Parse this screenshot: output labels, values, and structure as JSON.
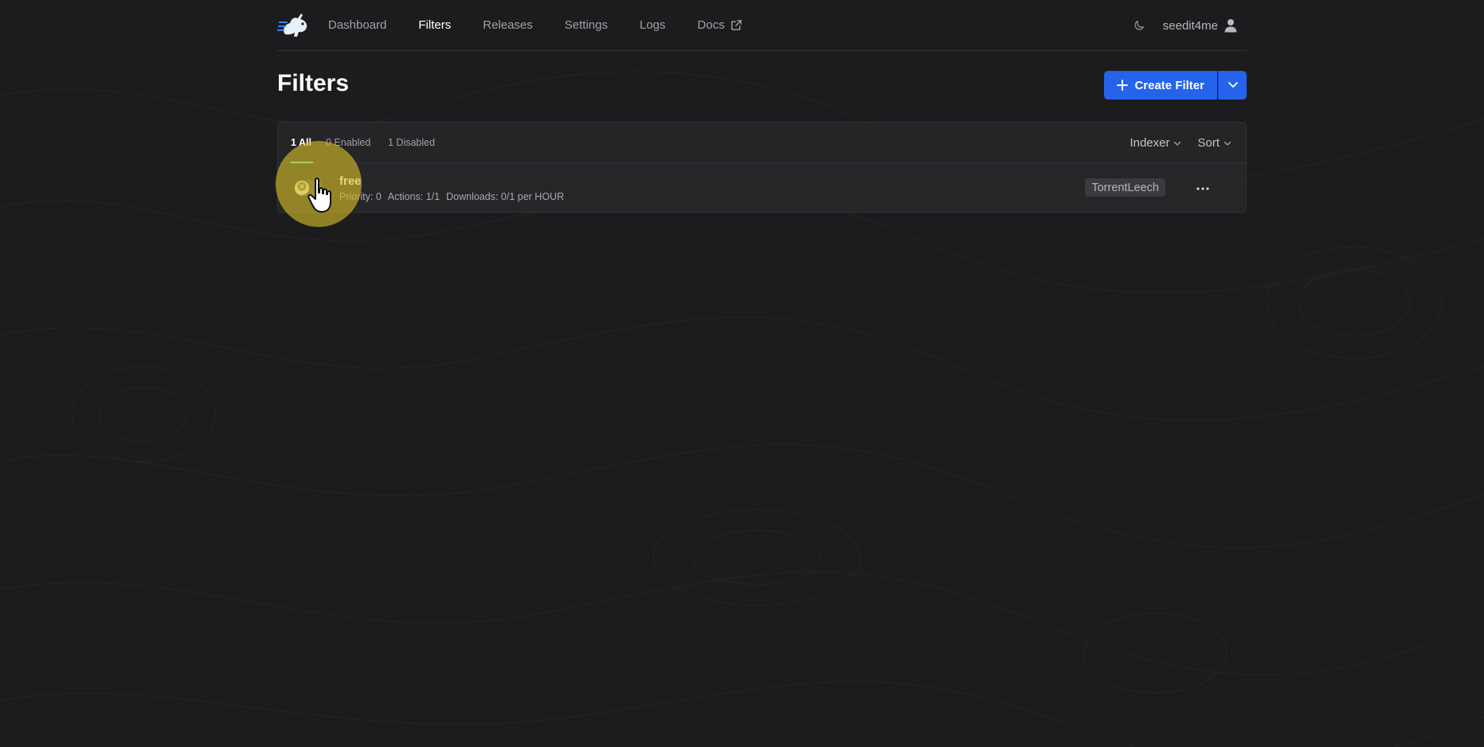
{
  "nav": {
    "logo_icon": "autobrr-rabbit-logo",
    "items": [
      {
        "label": "Dashboard",
        "active": false
      },
      {
        "label": "Filters",
        "active": true
      },
      {
        "label": "Releases",
        "active": false
      },
      {
        "label": "Settings",
        "active": false
      },
      {
        "label": "Logs",
        "active": false
      },
      {
        "label": "Docs",
        "active": false,
        "external": true
      }
    ],
    "theme_icon": "moon-icon",
    "username": "seedit4me",
    "user_icon": "user-icon"
  },
  "header": {
    "title": "Filters",
    "create_label": "Create Filter"
  },
  "tabs": [
    {
      "label": "1 All",
      "active": true
    },
    {
      "label": "0 Enabled",
      "active": false
    },
    {
      "label": "1 Disabled",
      "active": false
    }
  ],
  "dropdowns": {
    "indexer": "Indexer",
    "sort": "Sort"
  },
  "filters": [
    {
      "name": "free",
      "enabled": false,
      "priority": "Priority: 0",
      "actions": "Actions: 1/1",
      "downloads": "Downloads: 0/1 per HOUR",
      "indexer": "TorrentLeech"
    }
  ],
  "colors": {
    "background": "#1c1c1e",
    "accent": "#2563eb",
    "tab_underline": "#5eead4",
    "cursor_highlight": "#d6be28"
  }
}
